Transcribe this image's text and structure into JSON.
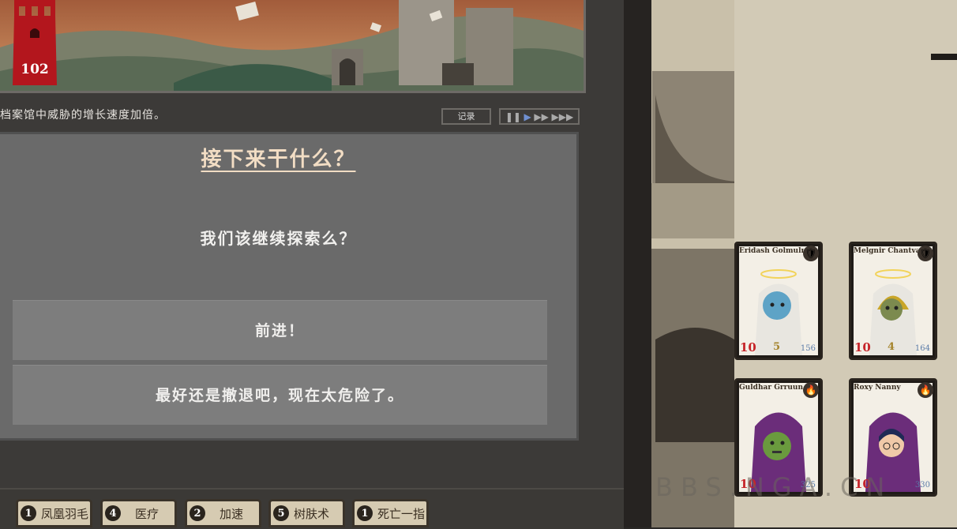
{
  "tower": {
    "value": "102"
  },
  "log": {
    "text": "档案馆中威胁的增长速度加倍。",
    "button_label": "记录"
  },
  "dialog": {
    "title": "接下来干什么？",
    "prompt": "我们该继续探索么？",
    "choices": [
      {
        "label": "前进！"
      },
      {
        "label": "最好还是撤退吧，现在太危险了。"
      }
    ]
  },
  "skills": [
    {
      "count": "1",
      "label": "凤凰羽毛"
    },
    {
      "count": "4",
      "label": "医疗"
    },
    {
      "count": "2",
      "label": "加速"
    },
    {
      "count": "5",
      "label": "树肤术"
    },
    {
      "count": "1",
      "label": "死亡一指"
    }
  ],
  "party": [
    {
      "name": "Eridash Golmuln",
      "hp": "10",
      "level": "5",
      "armor": "156",
      "badge_icon": "shield-icon"
    },
    {
      "name": "Melgnir Chantval",
      "hp": "10",
      "level": "4",
      "armor": "164",
      "badge_icon": "shield-icon"
    },
    {
      "name": "Guldhar Grruun",
      "hp": "10",
      "armor": "325",
      "badge_icon": "fire-icon"
    },
    {
      "name": "Roxy Nanny",
      "hp": "10",
      "armor": "330",
      "badge_icon": "fire-icon"
    }
  ],
  "watermark": "BBS.NGA.CN",
  "colors": {
    "tower_red": "#b3161d",
    "dialog_bg": "#6a6a6a",
    "choice_bg": "#7d7d7d",
    "title_color": "#f2ddc4",
    "hp_red": "#c6252a",
    "speed_active": "#6f8fd0"
  }
}
